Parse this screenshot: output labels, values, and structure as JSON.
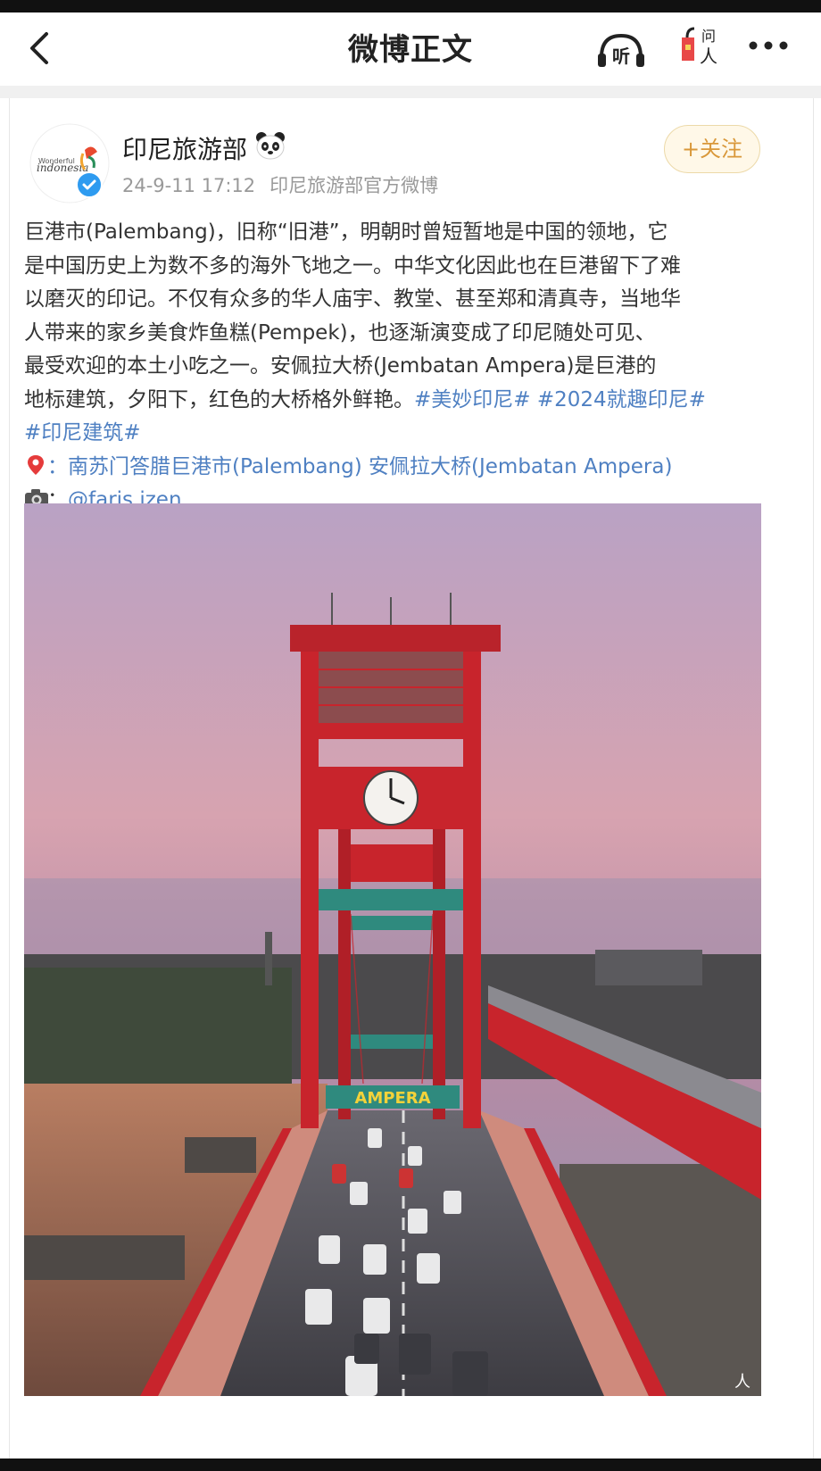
{
  "nav": {
    "title": "微博正文",
    "listen_label": "听",
    "ask_label": "问人"
  },
  "post": {
    "author": "印尼旅游部",
    "logo_text": "Wonderful Indonesia",
    "timestamp": "24-9-11 17:12",
    "source": "印尼旅游部官方微博",
    "follow_label": "+关注",
    "body_lines": [
      "巨港市(Palembang)，旧称“旧港”，明朝时曾短暂地是中国的领地，它",
      "是中国历史上为数不多的海外飞地之一。中华文化因此也在巨港留下了难",
      "以磨灭的印记。不仅有众多的华人庙宇、教堂、甚至郑和清真寺，当地华",
      "人带来的家乡美食炸鱼糕(Pempek)，也逐渐演变成了印尼随处可见、",
      "最受欢迎的本土小吃之一。安佩拉大桥(Jembatan Ampera)是巨港的"
    ],
    "body_last": "地标建筑，夕阳下，红色的大桥格外鲜艳。",
    "tags_line": [
      "#美妙印尼#",
      "#2024就趣印尼#"
    ],
    "tag_last": "#印尼建筑#",
    "location": "：南苏门答腊巨港市(Palembang) 安佩拉大桥(Jembatan Ampera)",
    "credit_prefix": "：",
    "credit_handle": "@faris.izen"
  },
  "photo": {
    "bridge_sign": "AMPERA",
    "clock_label": "clock",
    "corner_mark": "人"
  },
  "colors": {
    "bridge_red": "#c8242c",
    "link_blue": "#4f80c2",
    "follow_gold": "#d9983a"
  }
}
